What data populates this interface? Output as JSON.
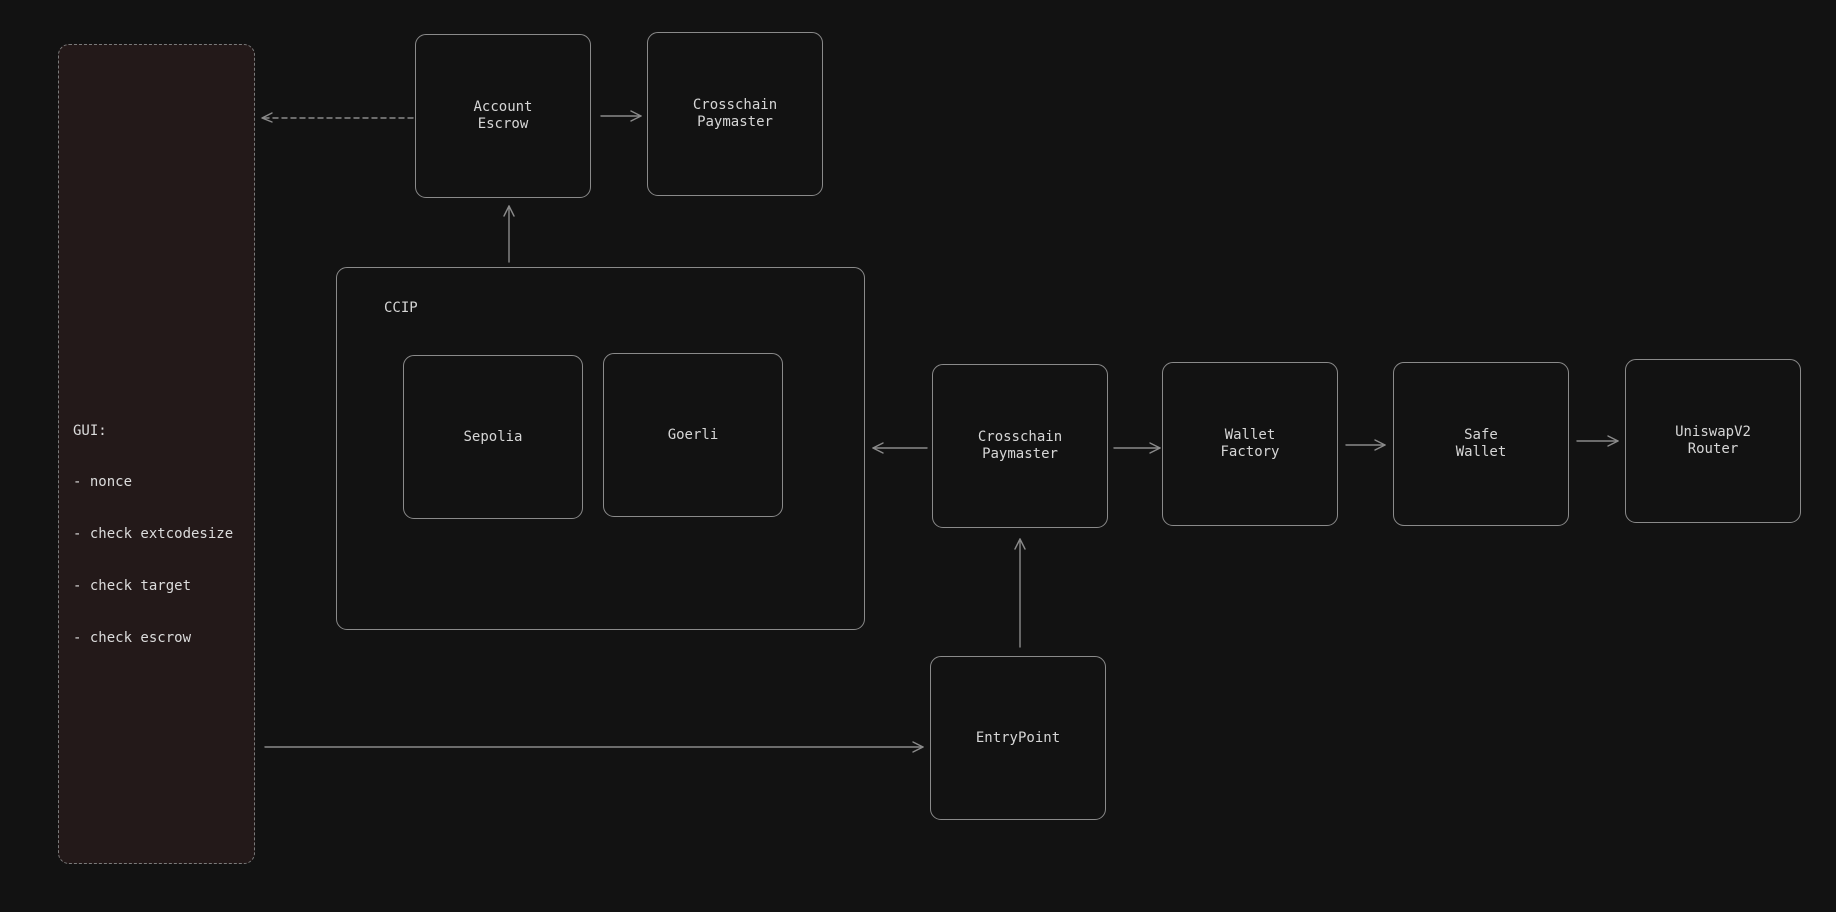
{
  "diagram": {
    "colors": {
      "background": "#121212",
      "node_border": "#8a8a8a",
      "edge": "#8a8a8a",
      "text": "#d6d6d6",
      "gui_fill": "#231919"
    },
    "gui_panel": {
      "title": "GUI:",
      "items": [
        "- nonce",
        "- check extcodesize",
        "- check target",
        "- check escrow"
      ]
    },
    "nodes": {
      "account_escrow": "Account\nEscrow",
      "crosschain_paymaster_top": "Crosschain\nPaymaster",
      "sepolia": "Sepolia",
      "goerli": "Goerli",
      "crosschain_paymaster": "Crosschain\nPaymaster",
      "wallet_factory": "Wallet\nFactory",
      "safe_wallet": "Safe\nWallet",
      "uniswap_router": "UniswapV2\nRouter",
      "entrypoint": "EntryPoint"
    },
    "ccip_group": {
      "label": "CCIP"
    },
    "edges": [
      {
        "from": "account_escrow",
        "to": "gui_panel",
        "style": "dashed"
      },
      {
        "from": "account_escrow",
        "to": "crosschain_paymaster_top",
        "style": "solid"
      },
      {
        "from": "ccip_group",
        "to": "account_escrow",
        "style": "solid"
      },
      {
        "from": "crosschain_paymaster",
        "to": "ccip_group",
        "style": "solid"
      },
      {
        "from": "crosschain_paymaster",
        "to": "wallet_factory",
        "style": "solid"
      },
      {
        "from": "wallet_factory",
        "to": "safe_wallet",
        "style": "solid"
      },
      {
        "from": "safe_wallet",
        "to": "uniswap_router",
        "style": "solid"
      },
      {
        "from": "entrypoint",
        "to": "crosschain_paymaster",
        "style": "solid"
      },
      {
        "from": "gui_panel",
        "to": "entrypoint",
        "style": "solid"
      }
    ]
  }
}
